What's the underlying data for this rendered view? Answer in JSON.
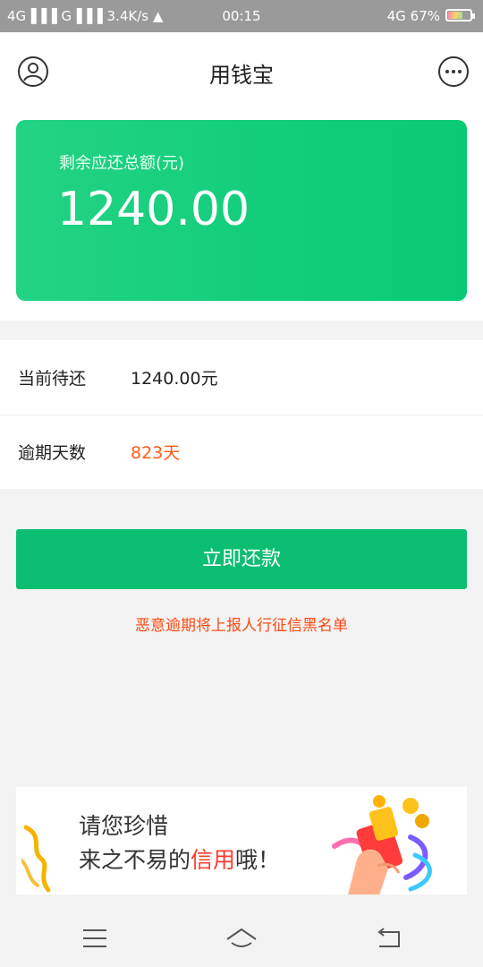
{
  "status_bar": {
    "left": "4G▐▐▐ G▐▐▐ 3.4K/s ▲",
    "time": "00:15",
    "right": "4G 67%",
    "battery_level_percent": 67
  },
  "header": {
    "title": "用钱宝",
    "profile_icon": "person-circle-icon",
    "more_icon": "more-dots-icon"
  },
  "summary_card": {
    "label": "剩余应还总额(元)",
    "amount": "1240.00",
    "colors": {
      "start": "#22d383",
      "end": "#08ca76"
    }
  },
  "details": {
    "current_due_label": "当前待还",
    "current_due_value": "1240.00元",
    "overdue_days_label": "逾期天数",
    "overdue_days_value": "823天",
    "overdue_color": "#ff5a14"
  },
  "repay_button": {
    "label": "立即还款",
    "color": "#0cbe72"
  },
  "warning": {
    "text": "恶意逾期将上报人行征信黑名单",
    "color": "#ff4a14"
  },
  "banner": {
    "line1": "请您珍惜",
    "line2_prefix": "来之不易的",
    "line2_highlight": "信用",
    "line2_suffix": "哦！",
    "highlight_color": "#ff3b2f"
  },
  "nav_bar": {
    "menu_icon": "menu-lines-icon",
    "home_icon": "home-icon",
    "back_icon": "back-arrow-icon"
  }
}
